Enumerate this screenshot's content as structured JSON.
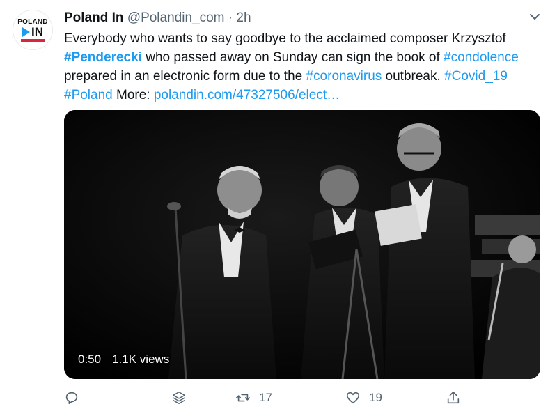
{
  "account": {
    "avatar_top": "POLAND",
    "avatar_bottom": "IN",
    "name": "Poland In",
    "handle": "@Polandin_com",
    "separator": "·",
    "time": "2h"
  },
  "tweet": {
    "line1": "Everybody who wants to say goodbye to the acclaimed composer Krzysztof",
    "hashtag_penderecki": "#Penderecki",
    "line2_mid": " who passed away on Sunday can sign the book of ",
    "hashtag_condolence": "#condolence",
    "line3_start": " prepared in an electronic form due to the ",
    "hashtag_coronavirus": "#coronavirus",
    "line3_mid": " outbreak. ",
    "hashtag_covid": "#Covid_19",
    "hashtag_poland": "#Poland",
    "more_label": " More: ",
    "link": "polandin.com/47327506/elect…"
  },
  "media": {
    "duration": "0:50",
    "views": "1.1K views"
  },
  "actions": {
    "retweets": "17",
    "likes": "19"
  },
  "colors": {
    "link": "#1d9bf0",
    "secondary": "#536471",
    "text": "#0f1419"
  }
}
